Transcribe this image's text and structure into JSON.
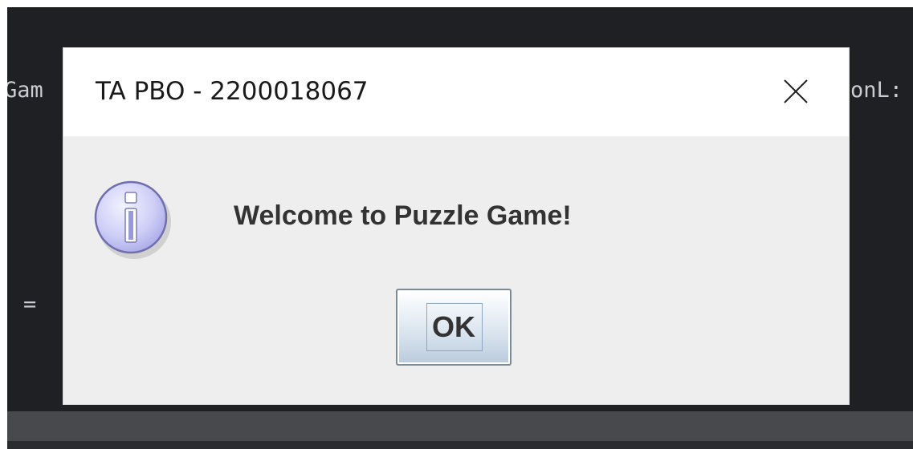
{
  "background_editor": {
    "code_left": "Gam",
    "code_right": "onL:",
    "code_eq": "="
  },
  "dialog": {
    "title": "TA PBO - 2200018067",
    "message": "Welcome to Puzzle Game!",
    "ok_label": "OK",
    "icon": "info-icon",
    "close_icon": "close-icon"
  },
  "colors": {
    "editor_background": "#1f2023",
    "dialog_background": "#eeeeee",
    "titlebar_background": "#ffffff",
    "info_icon_fill": "#c9c9f5"
  }
}
